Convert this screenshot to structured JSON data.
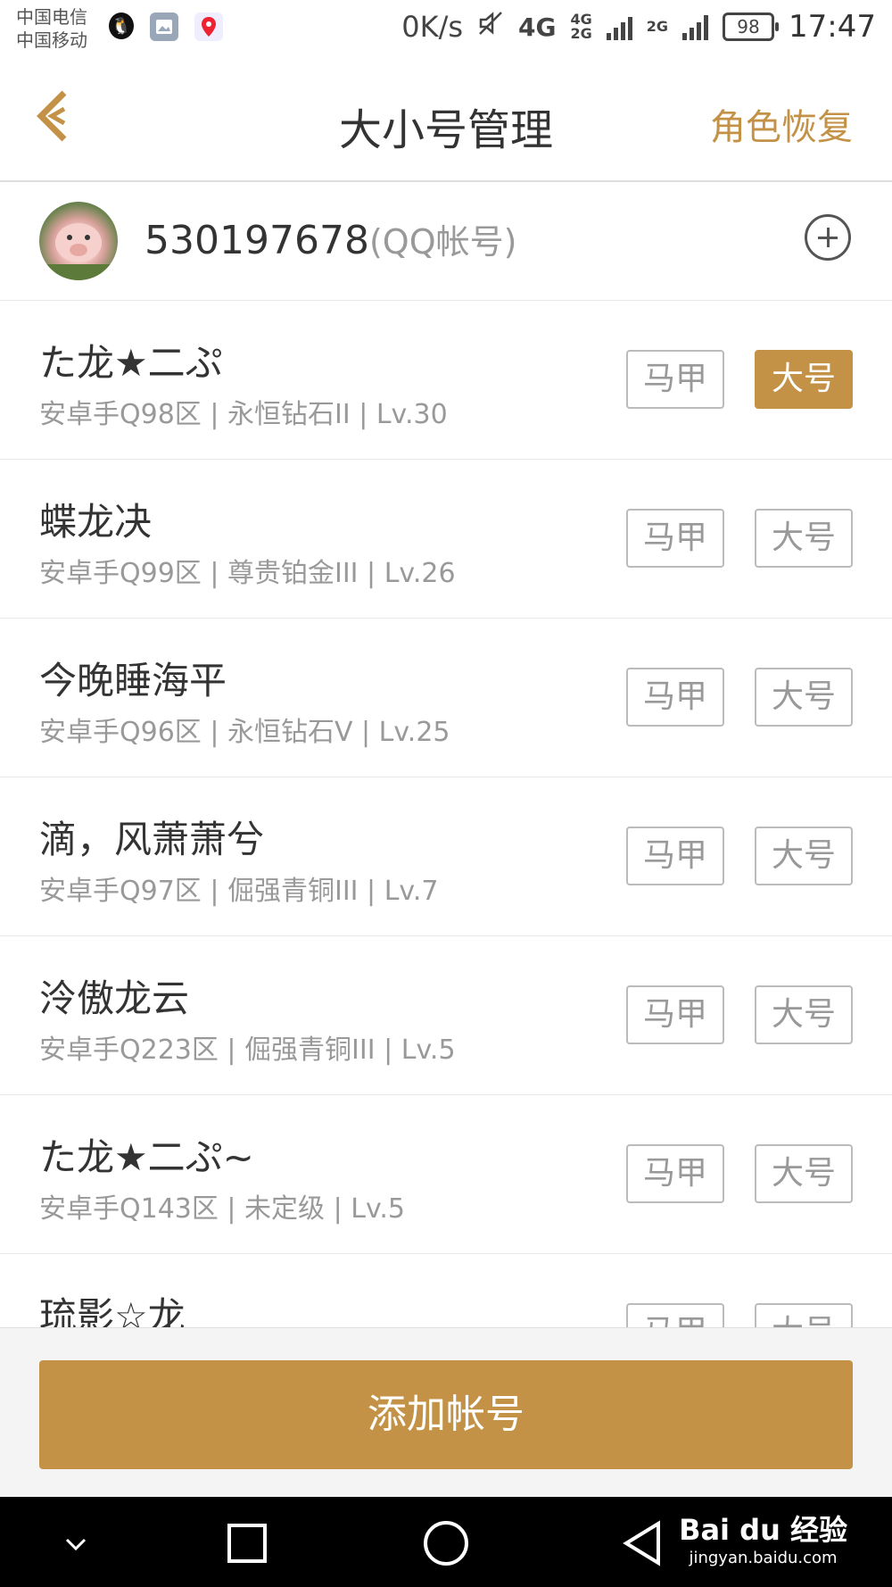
{
  "status_bar": {
    "carrier1": "中国电信",
    "carrier2": "中国移动",
    "net_speed": "0K/s",
    "net_type1": "4G",
    "net_type2": "4G",
    "net_type2b": "2G",
    "net_type3": "2G",
    "battery": "98",
    "time": "17:47"
  },
  "header": {
    "back_icon": "back-arrow-icon",
    "title": "大小号管理",
    "action": "角色恢复"
  },
  "account": {
    "number": "530197678",
    "type": "(QQ帐号)",
    "add_icon": "plus-circle-icon"
  },
  "roles": [
    {
      "name": "た龙★二ぷ",
      "info": "安卓手Q98区 | 永恒钻石II | Lv.30",
      "alt_label": "马甲",
      "main_label": "大号",
      "is_main": true
    },
    {
      "name": "蝶龙决",
      "info": "安卓手Q99区 | 尊贵铂金III | Lv.26",
      "alt_label": "马甲",
      "main_label": "大号",
      "is_main": false
    },
    {
      "name": "今晚睡海平",
      "info": "安卓手Q96区 | 永恒钻石V | Lv.25",
      "alt_label": "马甲",
      "main_label": "大号",
      "is_main": false
    },
    {
      "name": "滴，风萧萧兮",
      "info": "安卓手Q97区 | 倔强青铜III | Lv.7",
      "alt_label": "马甲",
      "main_label": "大号",
      "is_main": false
    },
    {
      "name": "泠傲龙云",
      "info": "安卓手Q223区 | 倔强青铜III | Lv.5",
      "alt_label": "马甲",
      "main_label": "大号",
      "is_main": false
    },
    {
      "name": "た龙★二ぷ~",
      "info": "安卓手Q143区 | 未定级 | Lv.5",
      "alt_label": "马甲",
      "main_label": "大号",
      "is_main": false
    },
    {
      "name": "琉影☆龙",
      "info": "",
      "alt_label": "马甲",
      "main_label": "大号",
      "is_main": false
    }
  ],
  "bottom": {
    "add_account": "添加帐号"
  },
  "watermark": {
    "brand": "Bai du 经验",
    "url": "jingyan.baidu.com"
  },
  "colors": {
    "accent": "#c39247"
  }
}
